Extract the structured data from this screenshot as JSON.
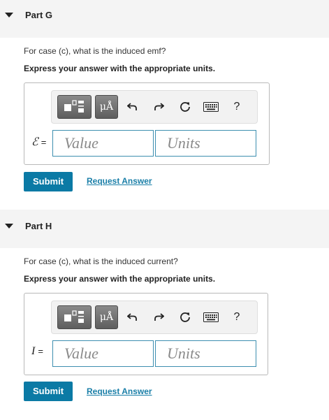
{
  "parts": [
    {
      "title": "Part G",
      "question": "For case (c), what is the induced emf?",
      "instruction": "Express your answer with the appropriate units.",
      "variable": "ℰ",
      "equals": "=",
      "value_placeholder": "Value",
      "units_placeholder": "Units",
      "submit_label": "Submit",
      "request_label": "Request Answer"
    },
    {
      "title": "Part H",
      "question": "For case (c), what is the induced current?",
      "instruction": "Express your answer with the appropriate units.",
      "variable": "I",
      "equals": "=",
      "value_placeholder": "Value",
      "units_placeholder": "Units",
      "submit_label": "Submit",
      "request_label": "Request Answer"
    }
  ],
  "toolbar": {
    "units_button_label": "μÅ",
    "help_label": "?",
    "icons": [
      "templates-icon",
      "units-icon",
      "undo-icon",
      "redo-icon",
      "reset-icon",
      "keyboard-icon",
      "help-icon"
    ]
  }
}
